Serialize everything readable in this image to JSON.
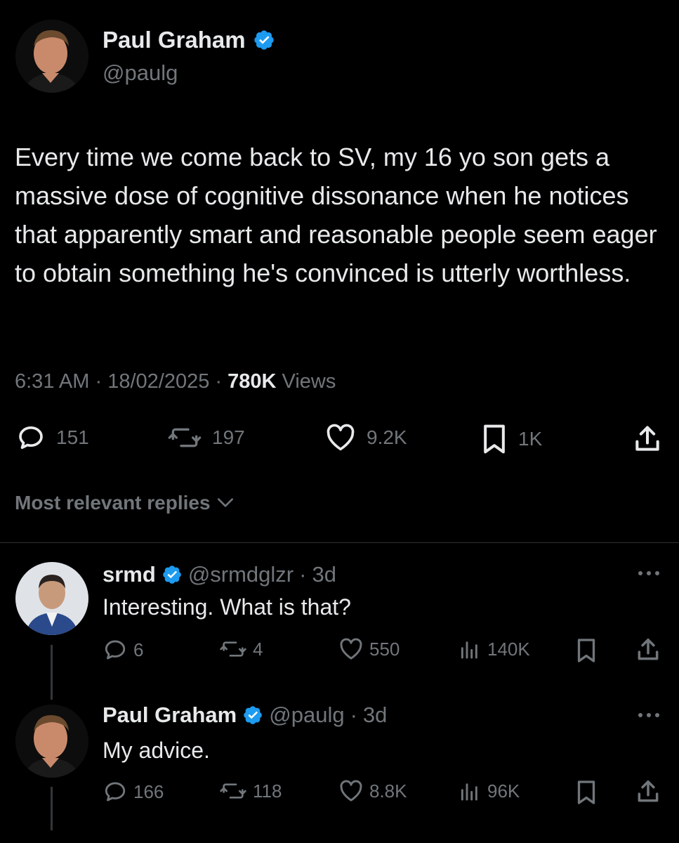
{
  "main_tweet": {
    "name": "Paul Graham",
    "handle": "@paulg",
    "text": "Every time we come back to SV, my 16 yo son gets a massive dose of cognitive dissonance when he notices that apparently smart and reasonable people seem eager to obtain something he's convinced is utterly worthless.",
    "time": "6:31 AM",
    "date": "18/02/2025",
    "views": "780K",
    "views_label": "Views",
    "sep": "·",
    "replies": "151",
    "retweets": "197",
    "likes": "9.2K",
    "bookmarks": "1K"
  },
  "sort_label": "Most relevant replies",
  "replies": [
    {
      "name": "srmd",
      "handle": "@srmdglzr",
      "sep": "·",
      "age": "3d",
      "text": "Interesting. What is that?",
      "replies": "6",
      "retweets": "4",
      "likes": "550",
      "views": "140K"
    },
    {
      "name": "Paul Graham",
      "handle": "@paulg",
      "sep": "·",
      "age": "3d",
      "text": "My advice.",
      "replies": "166",
      "retweets": "118",
      "likes": "8.8K",
      "views": "96K"
    }
  ],
  "colors": {
    "background": "#000000",
    "text": "#e7e9ea",
    "secondary": "#71767b",
    "verified": "#1d9bf0",
    "divider": "#2f3336"
  }
}
